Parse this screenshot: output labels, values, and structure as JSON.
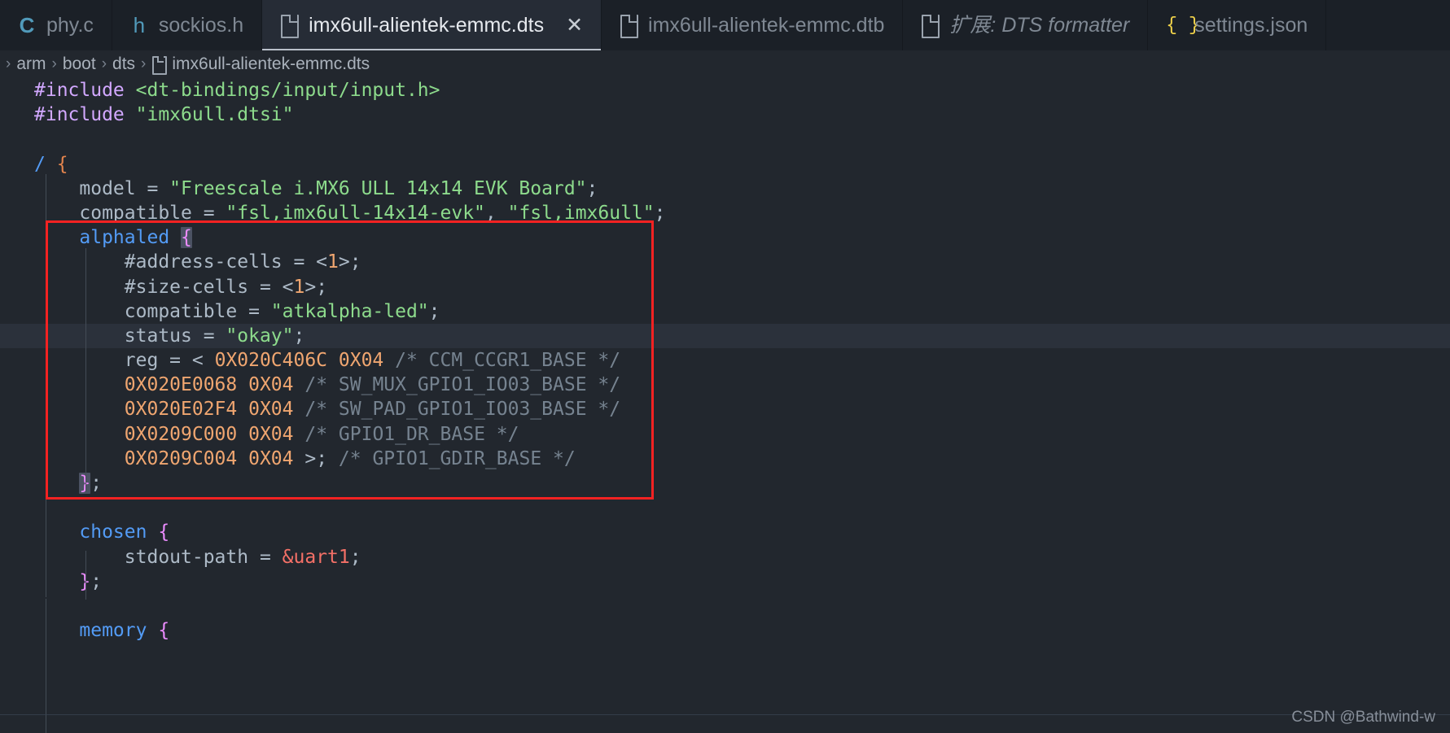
{
  "window": {
    "app": "Visual Studio Code",
    "theme_bg": "#22272e",
    "accent": "#539bf5",
    "annotation_color": "#f52222"
  },
  "tabs": [
    {
      "label": "phy.c",
      "icon": "c-file-icon",
      "icon_glyph": "C",
      "icon_color": "#519aba",
      "active": false,
      "preview": false,
      "closable": false
    },
    {
      "label": "sockios.h",
      "icon": "h-file-icon",
      "icon_glyph": "h",
      "icon_color": "#519aba",
      "active": false,
      "preview": false,
      "closable": false
    },
    {
      "label": "imx6ull-alientek-emmc.dts",
      "icon": "document-icon",
      "icon_glyph": "",
      "icon_color": "#9aa3ae",
      "active": true,
      "preview": false,
      "closable": true,
      "close_glyph": "✕"
    },
    {
      "label": "imx6ull-alientek-emmc.dtb",
      "icon": "document-icon",
      "icon_glyph": "",
      "icon_color": "#9aa3ae",
      "active": false,
      "preview": false,
      "closable": false
    },
    {
      "label": "扩展: DTS formatter",
      "icon": "document-icon",
      "icon_glyph": "",
      "icon_color": "#9aa3ae",
      "active": false,
      "preview": true,
      "closable": false
    },
    {
      "label": "settings.json",
      "icon": "json-file-icon",
      "icon_glyph": "{ }",
      "icon_color": "#f0d24a",
      "active": false,
      "preview": false,
      "closable": false
    }
  ],
  "breadcrumb": {
    "leading_separator": "›",
    "separator": "›",
    "items": [
      "arm",
      "boot",
      "dts"
    ],
    "file": "imx6ull-alientek-emmc.dts",
    "file_icon": "document-icon"
  },
  "editor": {
    "language": "dts",
    "highlighted_line_index": 12,
    "code_lines": [
      "#include <dt-bindings/input/input.h>",
      "#include \"imx6ull.dtsi\"",
      "",
      "/ {",
      "    model = \"Freescale i.MX6 ULL 14x14 EVK Board\";",
      "    compatible = \"fsl,imx6ull-14x14-evk\", \"fsl,imx6ull\";",
      "    alphaled {",
      "        #address-cells = <1>;",
      "        #size-cells = <1>;",
      "        compatible = \"atkalpha-led\";",
      "        status = \"okay\";",
      "        reg = < 0X020C406C 0X04 /* CCM_CCGR1_BASE */",
      "        0X020E0068 0X04 /* SW_MUX_GPIO1_IO03_BASE */",
      "        0X020E02F4 0X04 /* SW_PAD_GPIO1_IO03_BASE */",
      "        0X0209C000 0X04 /* GPIO1_DR_BASE */",
      "        0X0209C004 0X04 >; /* GPIO1_GDIR_BASE */",
      "    };",
      "",
      "    chosen {",
      "        stdout-path = &uart1;",
      "    };",
      "",
      "    memory {"
    ],
    "annotation": {
      "type": "red-rectangle",
      "encloses": "alphaled node block",
      "color": "#f52222"
    }
  },
  "watermark": {
    "text": "CSDN @Bathwind-w"
  }
}
